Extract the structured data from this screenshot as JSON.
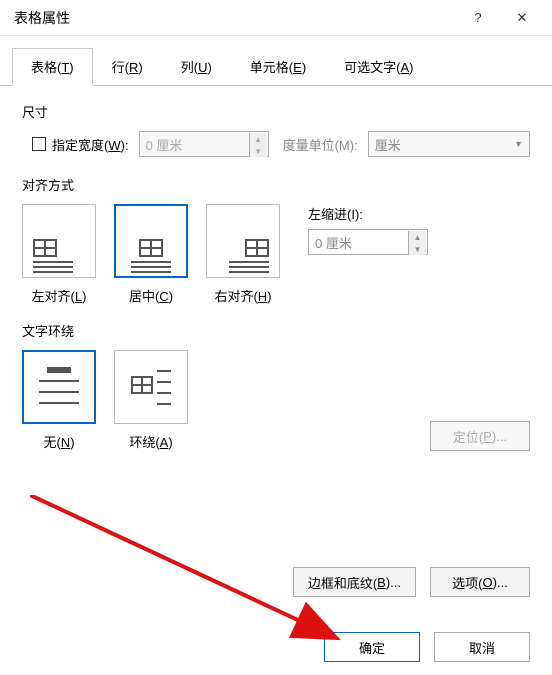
{
  "titlebar": {
    "title": "表格属性",
    "help": "?",
    "close": "✕"
  },
  "tabs": {
    "table": {
      "pre": "表格(",
      "u": "T",
      "post": ")"
    },
    "row": {
      "pre": "行(",
      "u": "R",
      "post": ")"
    },
    "col": {
      "pre": "列(",
      "u": "U",
      "post": ")"
    },
    "cell": {
      "pre": "单元格(",
      "u": "E",
      "post": ")"
    },
    "alt": {
      "pre": "可选文字(",
      "u": "A",
      "post": ")"
    }
  },
  "size": {
    "header": "尺寸",
    "preferWidth": {
      "pre": "指定宽度(",
      "u": "W",
      "post": "):"
    },
    "widthValue": "0 厘米",
    "unitLabel": "度量单位(M):",
    "unitValue": "厘米"
  },
  "align": {
    "header": "对齐方式",
    "left": {
      "pre": "左对齐(",
      "u": "L",
      "post": ")"
    },
    "center": {
      "pre": "居中(",
      "u": "C",
      "post": ")"
    },
    "right": {
      "pre": "右对齐(",
      "u": "H",
      "post": ")"
    },
    "indentLabel": "左缩进(I):",
    "indentValue": "0 厘米"
  },
  "wrap": {
    "header": "文字环绕",
    "none": {
      "pre": "无(",
      "u": "N",
      "post": ")"
    },
    "around": {
      "pre": "环绕(",
      "u": "A",
      "post": ")"
    },
    "positioning": {
      "pre": "定位(",
      "u": "P",
      "post": ")..."
    }
  },
  "bottom": {
    "borders": {
      "pre": "边框和底纹(",
      "u": "B",
      "post": ")..."
    },
    "options": {
      "pre": "选项(",
      "u": "O",
      "post": ")..."
    }
  },
  "footer": {
    "ok": "确定",
    "cancel": "取消"
  }
}
